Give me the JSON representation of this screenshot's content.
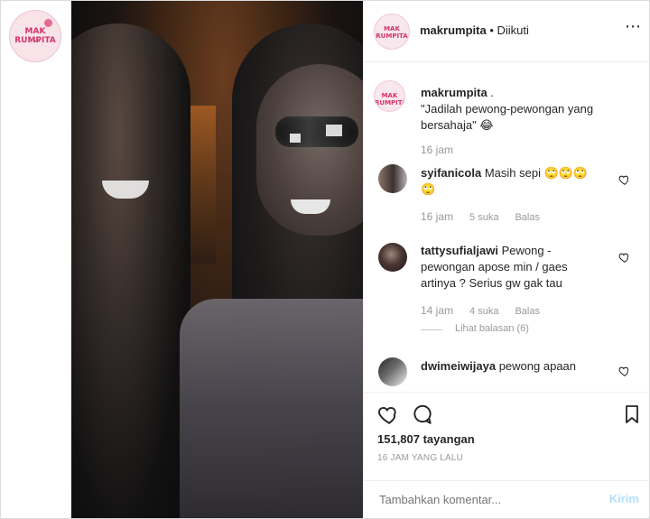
{
  "left_logo": {
    "text": "MAK RUMPITA"
  },
  "header": {
    "username": "makrumpita",
    "follow_text": " • Diikuti",
    "more": "⋯"
  },
  "caption": {
    "username": "makrumpita",
    "text": " .\n\"Jadilah pewong-pewongan yang bersahaja\" 😂",
    "time": "16 jam"
  },
  "comments": [
    {
      "username": "syifanicola",
      "text": " Masih sepi 🙄🙄🙄\n🙄",
      "time": "16 jam",
      "likes": "5 suka",
      "reply": "Balas"
    },
    {
      "username": "tattysufialjawi",
      "text": " Pewong -\npewongan apose min / gaes\nartinya ? Serius gw gak tau",
      "time": "14 jam",
      "likes": "4 suka",
      "reply": "Balas",
      "view_replies": "Lihat balasan (6)"
    },
    {
      "username": "dwimeiwijaya",
      "text": " pewong apaan"
    }
  ],
  "stats": {
    "views": "151,807 tayangan",
    "posted": "16 JAM YANG LALU"
  },
  "composer": {
    "placeholder": "Tambahkan komentar...",
    "send": "Kirim"
  }
}
